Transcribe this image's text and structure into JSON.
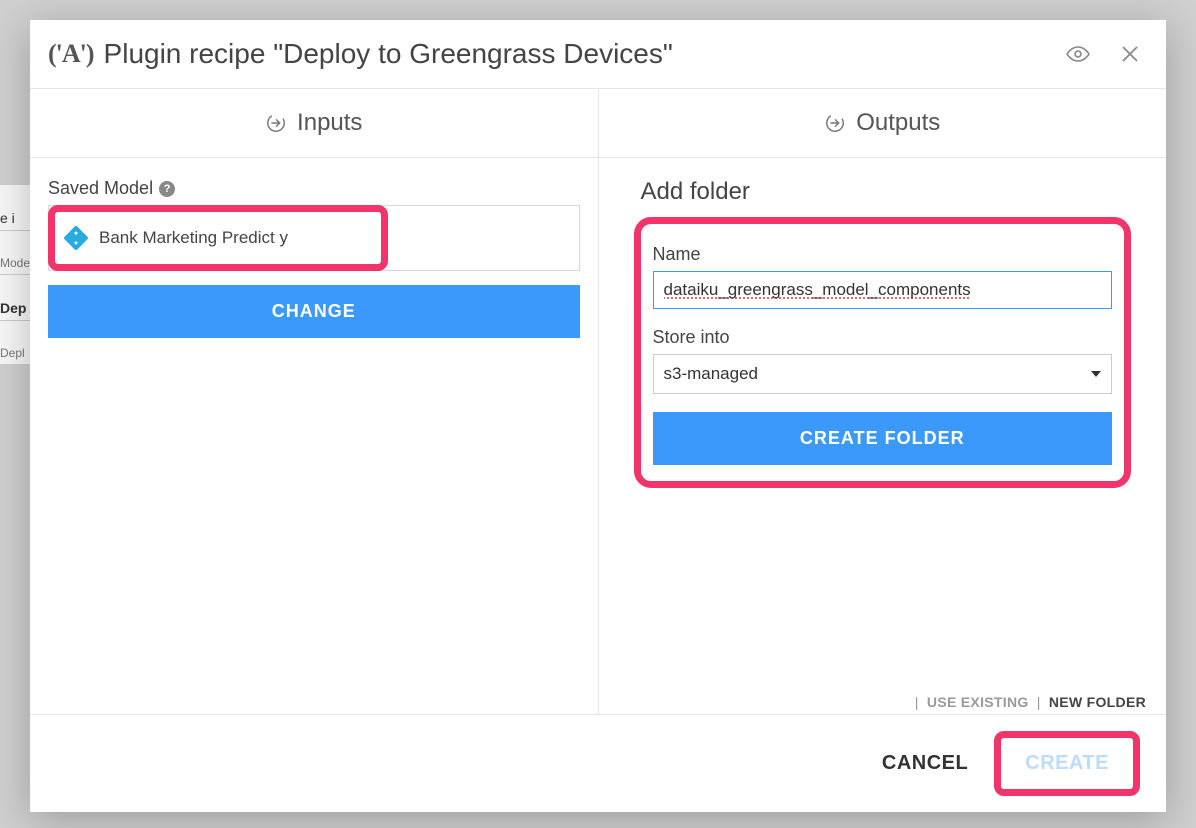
{
  "header": {
    "logo_text": "('A')",
    "title": "Plugin recipe \"Deploy to Greengrass Devices\""
  },
  "bg": {
    "item1": "e i",
    "item2": "Mode",
    "item3": "Dep",
    "item4": "Depl"
  },
  "inputs": {
    "title": "Inputs",
    "saved_model_label": "Saved Model",
    "model_name": "Bank Marketing Predict y",
    "change_label": "CHANGE"
  },
  "outputs": {
    "title": "Outputs",
    "section_title": "Add folder",
    "name_label": "Name",
    "name_value": "dataiku_greengrass_model_components",
    "store_into_label": "Store into",
    "store_into_value": "s3-managed",
    "create_folder_label": "CREATE FOLDER",
    "tab_use_existing": "USE EXISTING",
    "tab_new_folder": "NEW FOLDER"
  },
  "footer": {
    "cancel": "CANCEL",
    "create": "CREATE"
  }
}
